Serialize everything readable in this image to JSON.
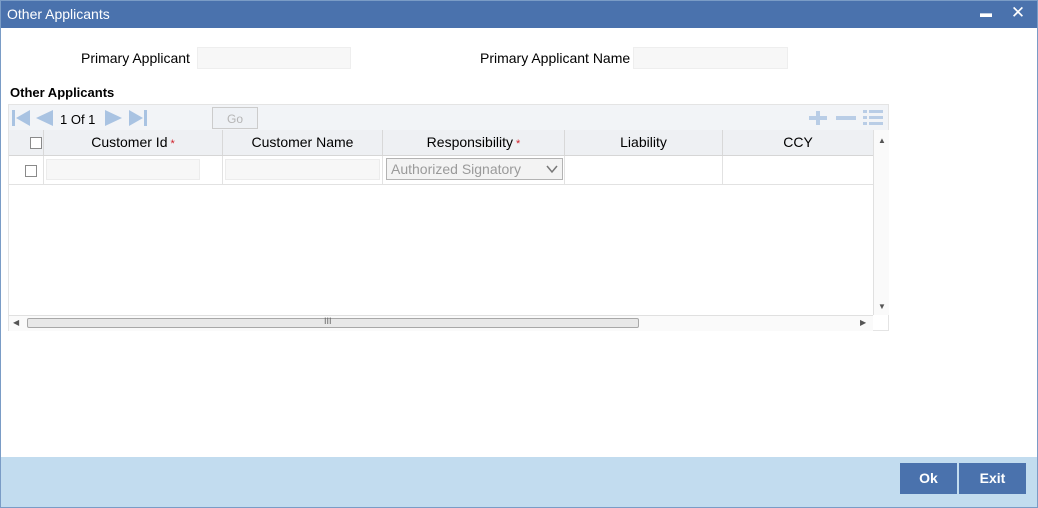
{
  "window": {
    "title": "Other Applicants",
    "minimize_glyph": "▬",
    "close_glyph": "✕"
  },
  "form": {
    "primary_applicant_label": "Primary Applicant",
    "primary_applicant_value": "",
    "primary_applicant_name_label": "Primary Applicant Name",
    "primary_applicant_name_value": ""
  },
  "section": {
    "title": "Other Applicants"
  },
  "grid": {
    "pager": "1 Of 1",
    "page_input": "",
    "go_label": "Go",
    "icons": [
      "first-page-icon",
      "prev-page-icon",
      "next-page-icon",
      "last-page-icon",
      "add-row-icon",
      "delete-row-icon",
      "single-view-icon"
    ],
    "columns": [
      {
        "label": "Customer Id",
        "required": true
      },
      {
        "label": "Customer Name",
        "required": false
      },
      {
        "label": "Responsibility",
        "required": true
      },
      {
        "label": "Liability",
        "required": false
      },
      {
        "label": "CCY",
        "required": false
      }
    ],
    "required_mark": "*",
    "rows": [
      {
        "customer_id": "",
        "customer_name": "",
        "responsibility": "Authorized Signatory",
        "liability": "",
        "ccy": ""
      }
    ],
    "scroll_thumb_glyph": "III"
  },
  "footer": {
    "ok_label": "Ok",
    "exit_label": "Exit"
  },
  "colors": {
    "titlebar": "#4a72ad",
    "footer": "#c2dcef",
    "button": "#4a72ad",
    "required": "#d0202a",
    "nav_icon": "#a9c3e2"
  }
}
